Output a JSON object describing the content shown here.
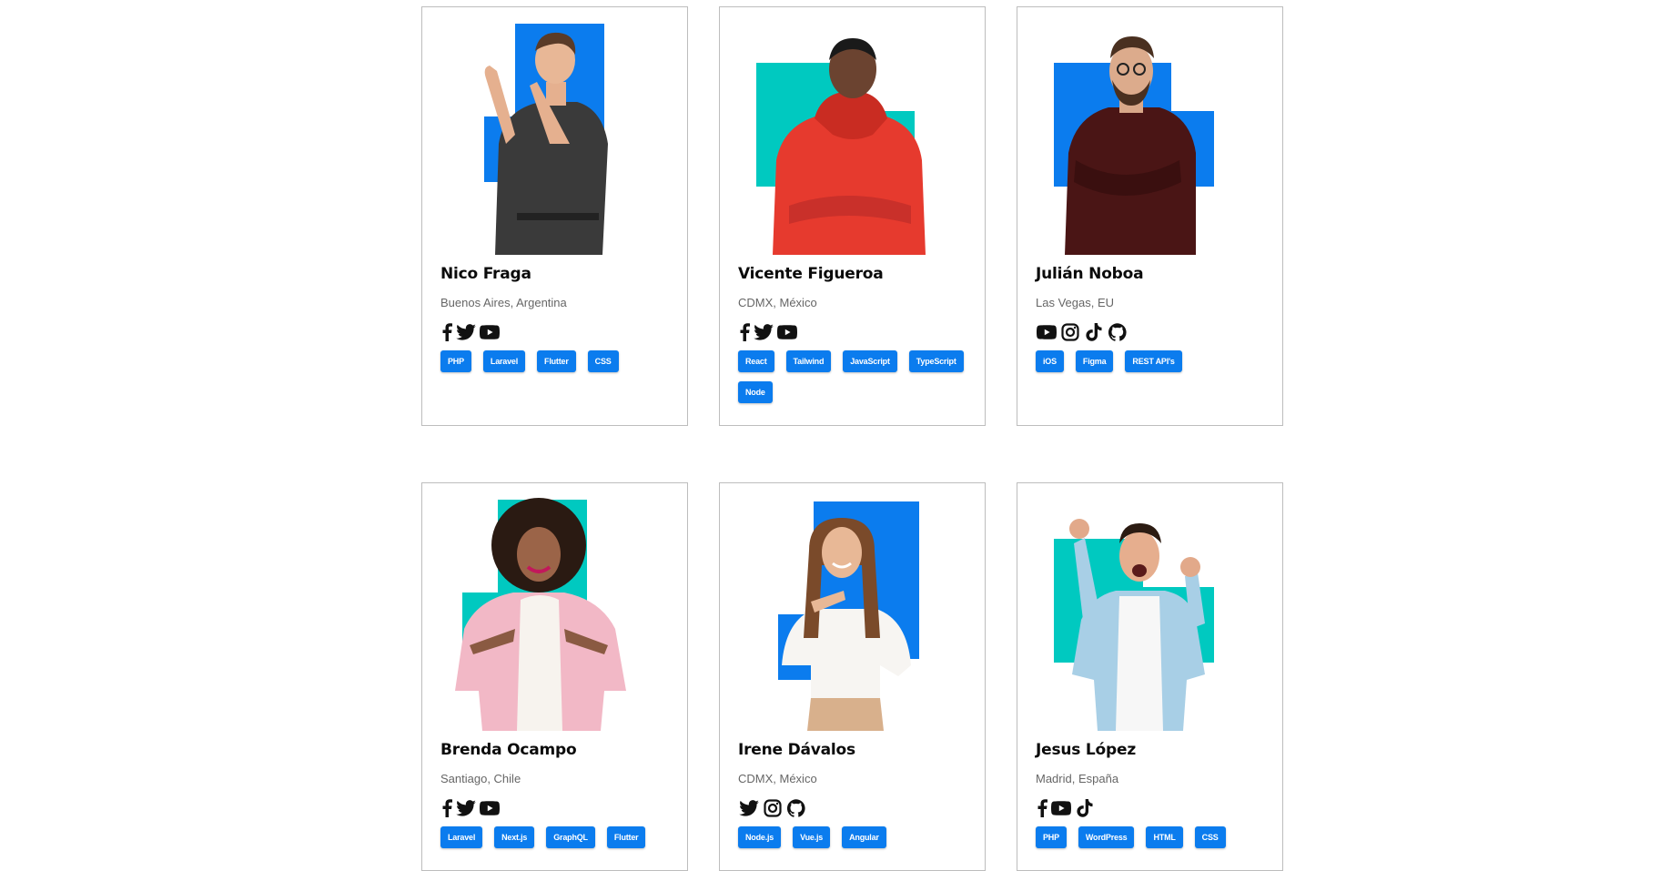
{
  "colors": {
    "blue": "#0b7cee",
    "teal": "#00c9c0",
    "border": "#bdbdbd"
  },
  "members": [
    {
      "name": "Nico Fraga",
      "location": "Buenos Aires, Argentina",
      "social": [
        "facebook-icon",
        "twitter-icon",
        "youtube-icon"
      ],
      "skills": [
        "PHP",
        "Laravel",
        "Flutter",
        "CSS"
      ]
    },
    {
      "name": "Vicente Figueroa",
      "location": "CDMX, México",
      "social": [
        "facebook-icon",
        "twitter-icon",
        "youtube-icon"
      ],
      "skills": [
        "React",
        "Tailwind",
        "JavaScript",
        "TypeScript",
        "Node"
      ]
    },
    {
      "name": "Julián Noboa",
      "location": "Las Vegas, EU",
      "social": [
        "youtube-icon",
        "instagram-icon",
        "tiktok-icon",
        "github-icon"
      ],
      "skills": [
        "iOS",
        "Figma",
        "REST API's"
      ]
    },
    {
      "name": "Brenda Ocampo",
      "location": "Santiago, Chile",
      "social": [
        "facebook-icon",
        "twitter-icon",
        "youtube-icon"
      ],
      "skills": [
        "Laravel",
        "Next.js",
        "GraphQL",
        "Flutter"
      ]
    },
    {
      "name": "Irene Dávalos",
      "location": "CDMX, México",
      "social": [
        "twitter-icon",
        "instagram-icon",
        "github-icon"
      ],
      "skills": [
        "Node.js",
        "Vue.js",
        "Angular"
      ]
    },
    {
      "name": "Jesus López",
      "location": "Madrid, España",
      "social": [
        "facebook-icon",
        "youtube-icon",
        "tiktok-icon"
      ],
      "skills": [
        "PHP",
        "WordPress",
        "HTML",
        "CSS"
      ]
    }
  ]
}
